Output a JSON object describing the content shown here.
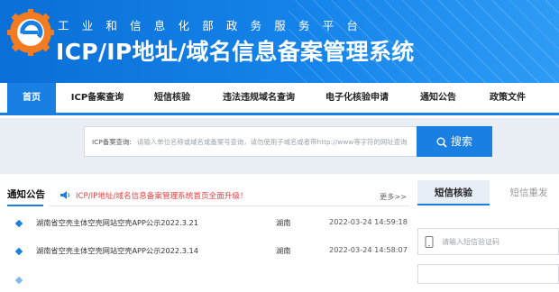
{
  "header": {
    "subtitle": "工业和信息化部政务服务平台",
    "title": "ICP/IP地址/域名信息备案管理系统"
  },
  "nav": {
    "items": [
      {
        "label": "首页",
        "active": true
      },
      {
        "label": "ICP备案查询",
        "active": false
      },
      {
        "label": "短信核验",
        "active": false
      },
      {
        "label": "违法违规域名查询",
        "active": false
      },
      {
        "label": "电子化核验申请",
        "active": false
      },
      {
        "label": "通知公告",
        "active": false
      },
      {
        "label": "政策文件",
        "active": false
      }
    ]
  },
  "search": {
    "prefix": "ICP备案查询:",
    "placeholder": "请输入单位名称或域名或备案号查询，请勿使用子域名或者带http://www等字符的网址查询",
    "button_label": "搜索"
  },
  "notice": {
    "heading": "通知公告",
    "announcement": "ICP/IP地址/域名信息备案管理系统首页全面升级！",
    "more_label": "更多>>",
    "rows": [
      {
        "title": "湖南省空壳主体空壳网站空壳APP公示2022.3.21",
        "region": "湖南",
        "date": "2022-03-24 14:59:18"
      },
      {
        "title": "湖南省空壳主体空壳网站空壳APP公示2022.3.14",
        "region": "湖南",
        "date": "2022-03-24 14:58:07"
      }
    ]
  },
  "side_tabs": {
    "active": "短信核验",
    "inactive": "短信重发"
  },
  "sms": {
    "code_placeholder": "请输入短信验证码"
  },
  "colors": {
    "brand_blue": "#1a7fe3",
    "header_start": "#0a6fd6",
    "announce_red": "#e64040"
  }
}
